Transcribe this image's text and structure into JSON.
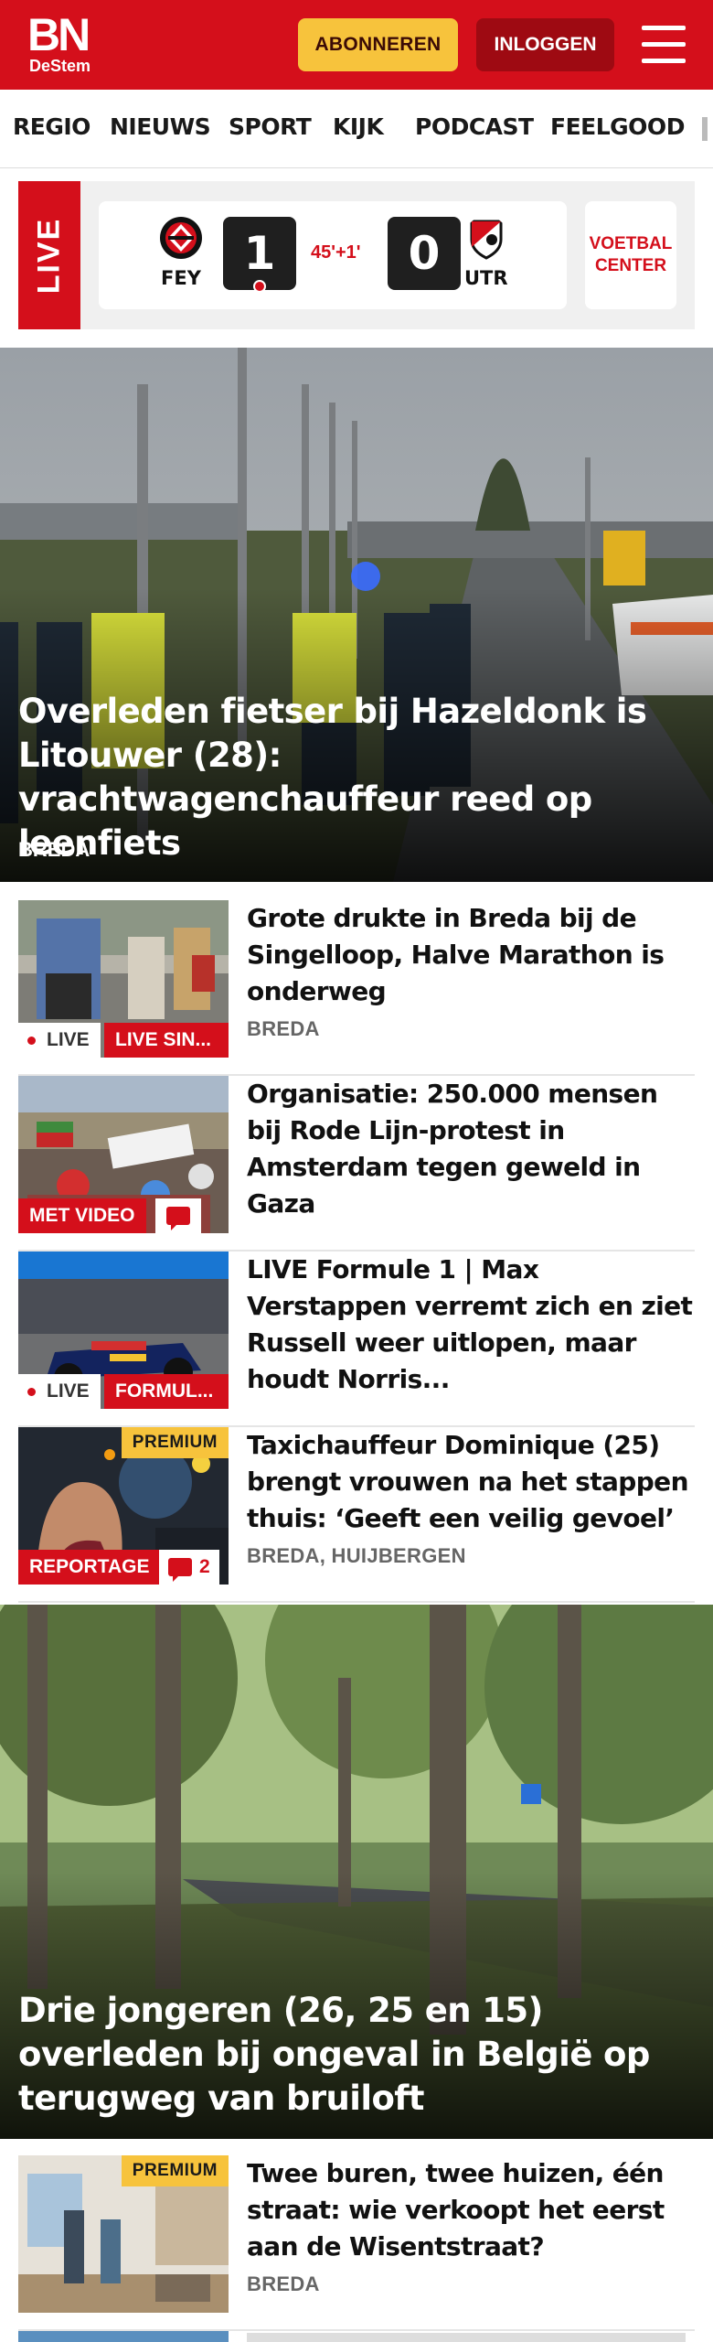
{
  "header": {
    "logo_main": "BN",
    "logo_sub": "DeStem",
    "subscribe_label": "ABONNEREN",
    "login_label": "INLOGGEN",
    "colors": {
      "brand": "#d40f1b",
      "accent": "#f7c33c"
    }
  },
  "nav": {
    "items": [
      "REGIO",
      "NIEUWS",
      "SPORT",
      "KIJK",
      "PODCAST",
      "FEELGOOD"
    ]
  },
  "live": {
    "tag": "LIVE",
    "home_team": "FEY",
    "away_team": "UTR",
    "home_score": "1",
    "away_score": "0",
    "minute": "45'+1'",
    "voetbal_line1": "VOETBAL",
    "voetbal_line2": "CENTER"
  },
  "hero1": {
    "title": "Overleden fietser bij Hazeldonk is Litouwer (28): vrachtwagenchauffeur reed op leenfiets",
    "location": "BREDA"
  },
  "articles": [
    {
      "title": "Grote drukte in Breda bij de Singelloop, Halve Marathon is onderweg",
      "location": "BREDA",
      "live_label": "LIVE",
      "tag": "LIVE SIN..."
    },
    {
      "title": "Organisatie: 250.000 mensen bij Rode Lijn-protest in Amsterdam tegen geweld in Gaza",
      "tag": "MET VIDEO"
    },
    {
      "title": "LIVE Formule 1 | Max Verstappen verremt zich en ziet Russell weer uitlopen, maar houdt Norris...",
      "live_label": "LIVE",
      "tag": "FORMUL..."
    },
    {
      "title": "Taxichauffeur Dominique (25) brengt vrouwen na het stappen thuis: ‘Geeft een veilig gevoel’",
      "location": "BREDA, HUIJBERGEN",
      "premium": "PREMIUM",
      "tag": "REPORTAGE",
      "comments": "2"
    }
  ],
  "hero2": {
    "title": "Drie jongeren (26, 25 en 15) overleden bij ongeval in België op terugweg van bruiloft"
  },
  "article5": {
    "title": "Twee buren, twee huizen, één straat: wie verkoopt het eerst aan de Wisentstraat?",
    "location": "BREDA",
    "premium": "PREMIUM"
  }
}
